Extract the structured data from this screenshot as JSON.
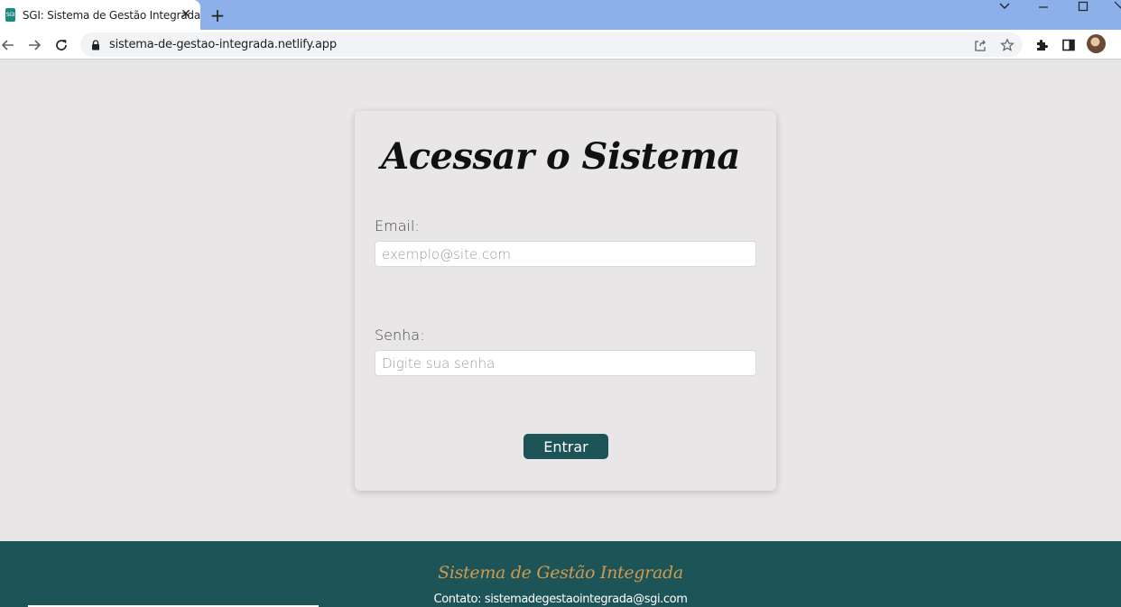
{
  "browser": {
    "tab": {
      "favicon_text": "SGI",
      "title": "SGI: Sistema de Gestão Integrada",
      "close_glyph": "✕"
    },
    "new_tab_glyph": "+",
    "url": "sistema-de-gestao-integrada.netlify.app",
    "icons": [
      "back-arrow-icon",
      "forward-arrow-icon",
      "reload-icon",
      "lock-icon",
      "share-icon",
      "star-icon",
      "extensions-icon",
      "side-panel-icon",
      "avatar"
    ]
  },
  "login": {
    "title": "Acessar o Sistema",
    "email_label": "Email:",
    "email_placeholder": "exemplo@site.com",
    "password_label": "Senha:",
    "password_placeholder": "Digite sua senha",
    "submit_label": "Entrar"
  },
  "footer": {
    "brand": "Sistema de Gestão Integrada",
    "contact": "Contato: sistemadegestaointegrada@sgi.com"
  },
  "colors": {
    "page_bg": "#e8e6e7",
    "accent": "#1d5458",
    "footer_brand": "#d09a4e",
    "tabbar": "#8db0ea"
  }
}
